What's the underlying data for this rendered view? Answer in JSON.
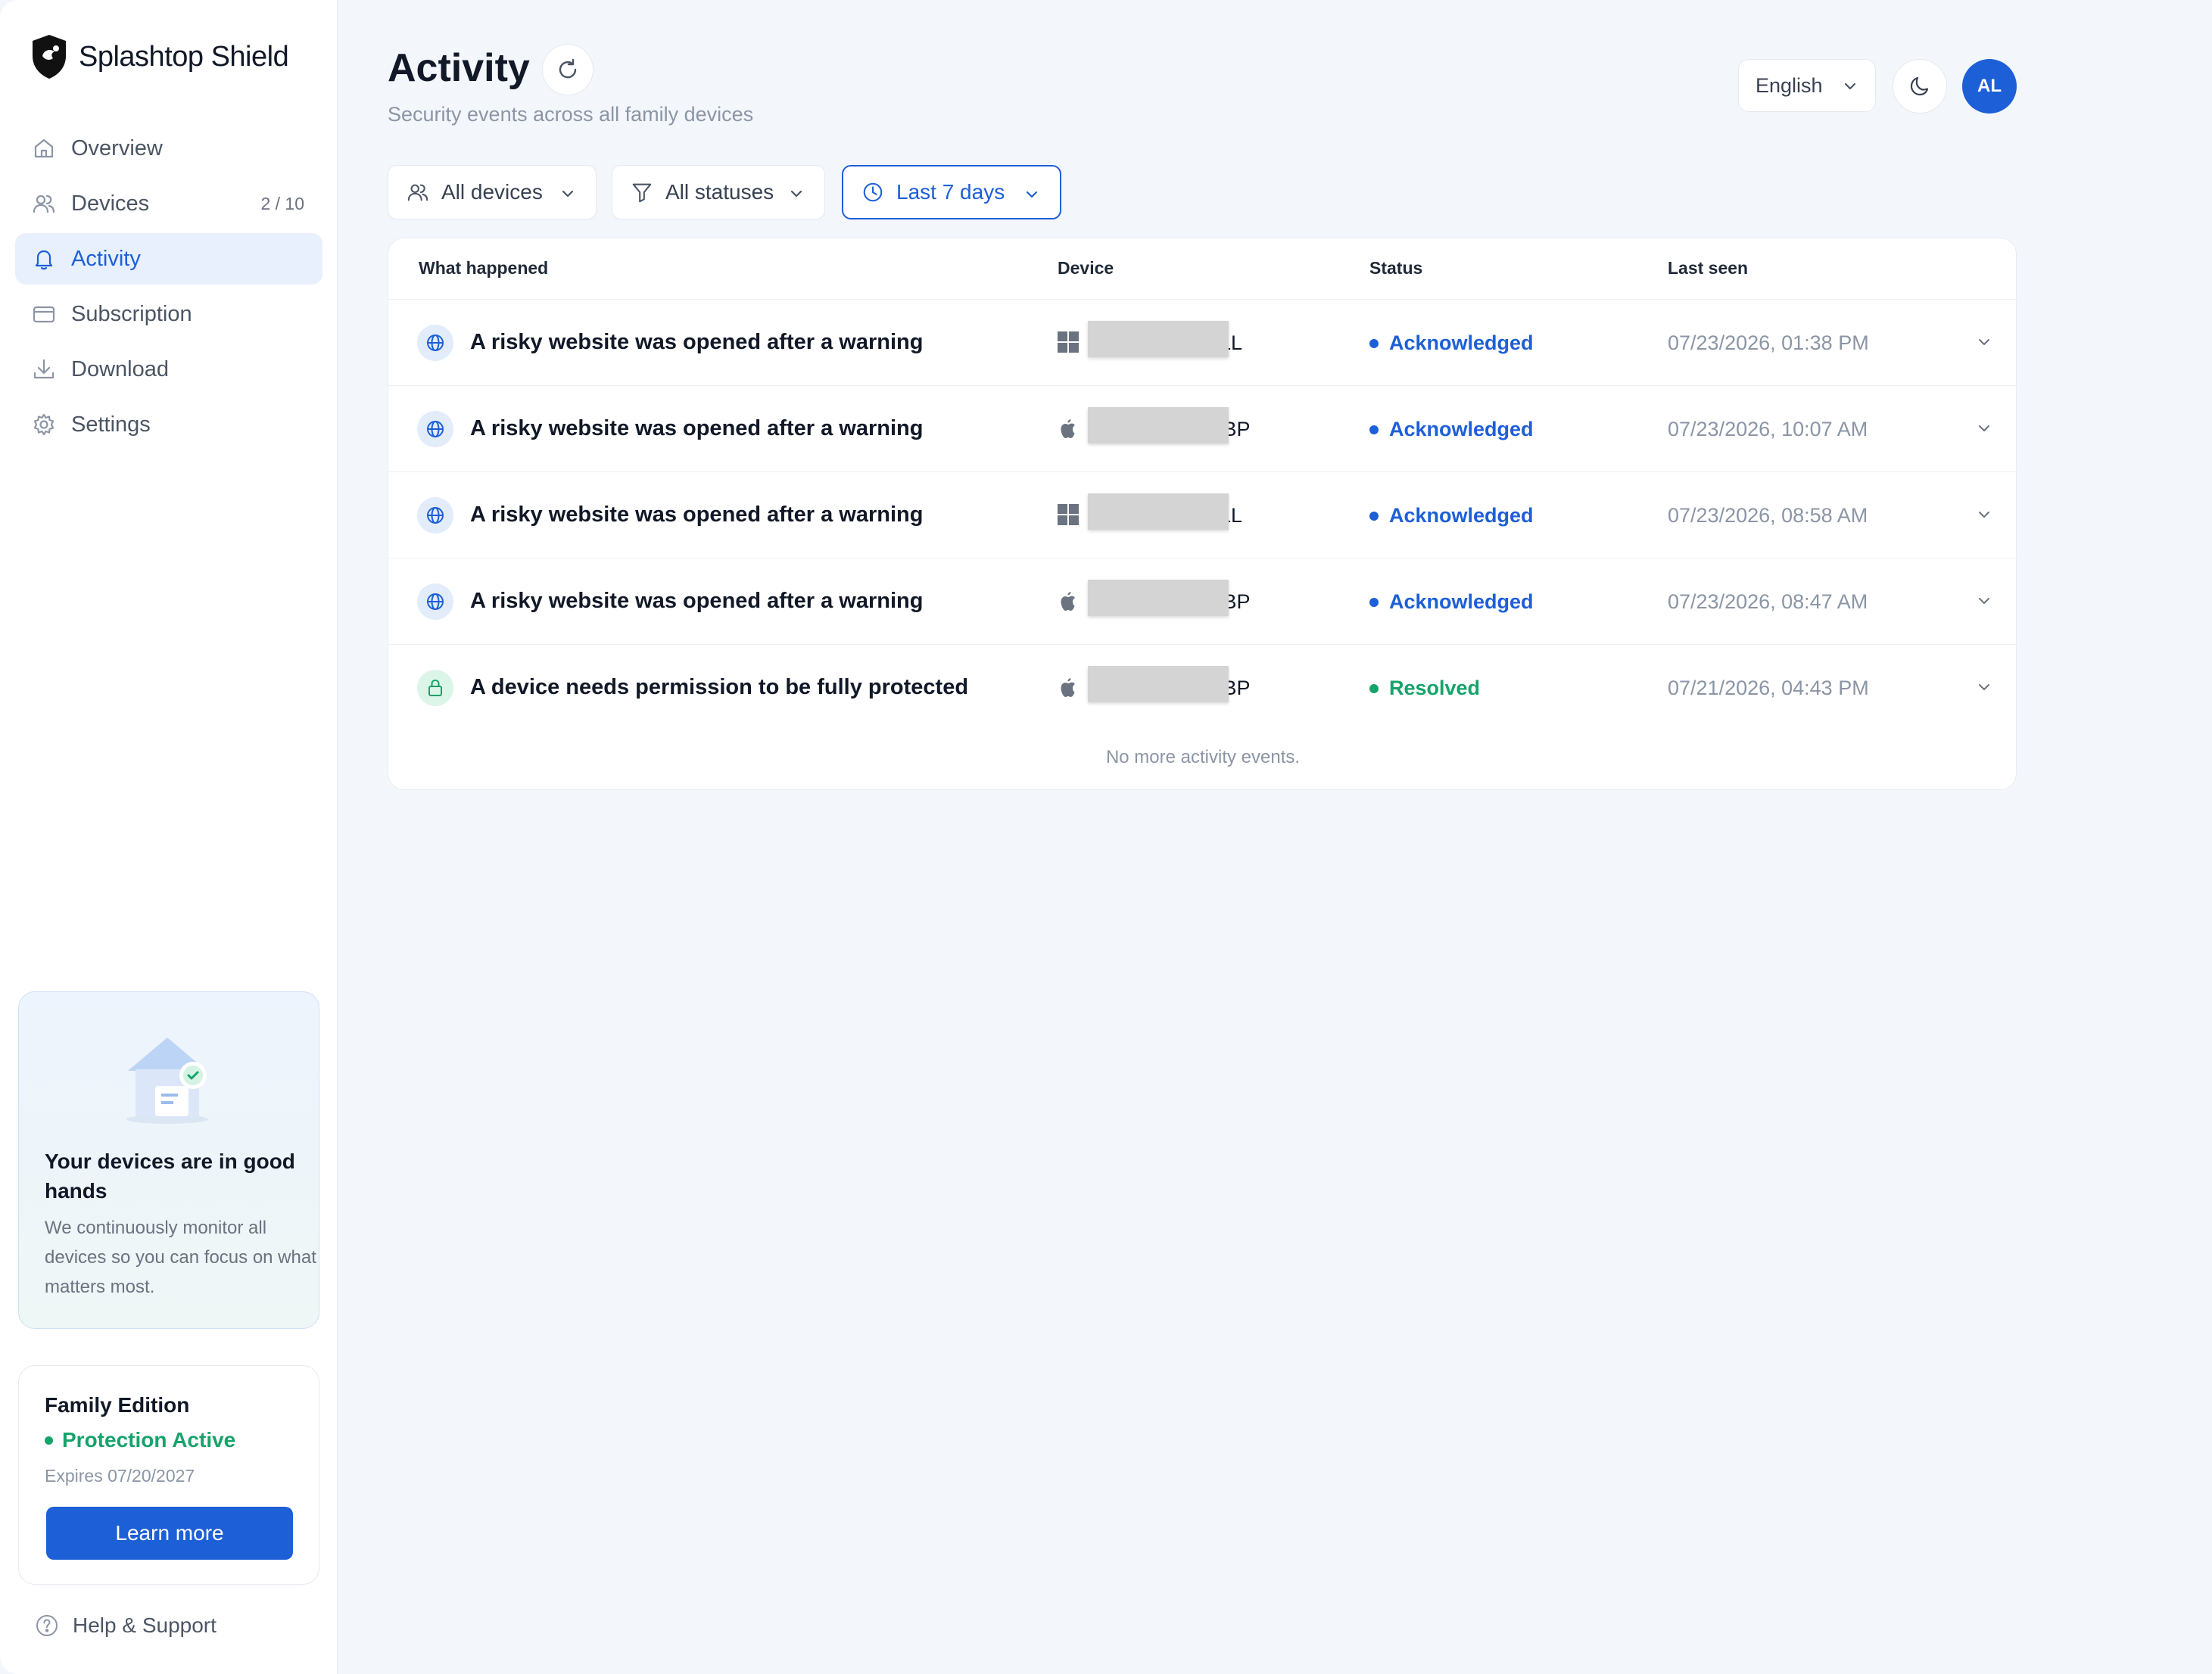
{
  "brand": {
    "name": "Splashtop Shield"
  },
  "sidebar": {
    "items": [
      {
        "label": "Overview",
        "icon": "home-icon",
        "count": ""
      },
      {
        "label": "Devices",
        "icon": "users-icon",
        "count": "2 / 10"
      },
      {
        "label": "Activity",
        "icon": "bell-icon",
        "count": "",
        "active": true
      },
      {
        "label": "Subscription",
        "icon": "credit-card-icon",
        "count": ""
      },
      {
        "label": "Download",
        "icon": "download-icon",
        "count": ""
      },
      {
        "label": "Settings",
        "icon": "gear-icon",
        "count": ""
      }
    ],
    "promo": {
      "title": "Your devices are in good hands",
      "text": "We continuously monitor all devices so you can focus on what matters most."
    },
    "plan": {
      "title": "Family Edition",
      "status": "Protection Active",
      "expires": "Expires 07/20/2027",
      "button": "Learn more"
    },
    "help": "Help & Support"
  },
  "header": {
    "title": "Activity",
    "subtitle": "Security events across all family devices",
    "language": "English",
    "avatar_initials": "AL"
  },
  "filters": {
    "devices": "All devices",
    "statuses": "All statuses",
    "range": "Last 7 days"
  },
  "table": {
    "columns": [
      "What happened",
      "Device",
      "Status",
      "Last seen"
    ],
    "rows": [
      {
        "event": "A risky website was opened after a warning",
        "type": "globe",
        "os": "windows",
        "device": "ELL",
        "status": "Acknowledged",
        "last_seen": "07/23/2026, 01:38 PM"
      },
      {
        "event": "A risky website was opened after a warning",
        "type": "globe",
        "os": "apple",
        "device": "MBP",
        "status": "Acknowledged",
        "last_seen": "07/23/2026, 10:07 AM"
      },
      {
        "event": "A risky website was opened after a warning",
        "type": "globe",
        "os": "windows",
        "device": "ELL",
        "status": "Acknowledged",
        "last_seen": "07/23/2026, 08:58 AM"
      },
      {
        "event": "A risky website was opened after a warning",
        "type": "globe",
        "os": "apple",
        "device": "MBP",
        "status": "Acknowledged",
        "last_seen": "07/23/2026, 08:47 AM"
      },
      {
        "event": "A device needs permission to be fully protected",
        "type": "lock",
        "os": "apple",
        "device": "MBP",
        "status": "Resolved",
        "last_seen": "07/21/2026, 04:43 PM"
      }
    ],
    "footer": "No more activity events."
  },
  "colors": {
    "accent": "#1d5fd6",
    "success": "#16a36b",
    "muted": "#8b95a5",
    "background": "#f3f6fb"
  }
}
